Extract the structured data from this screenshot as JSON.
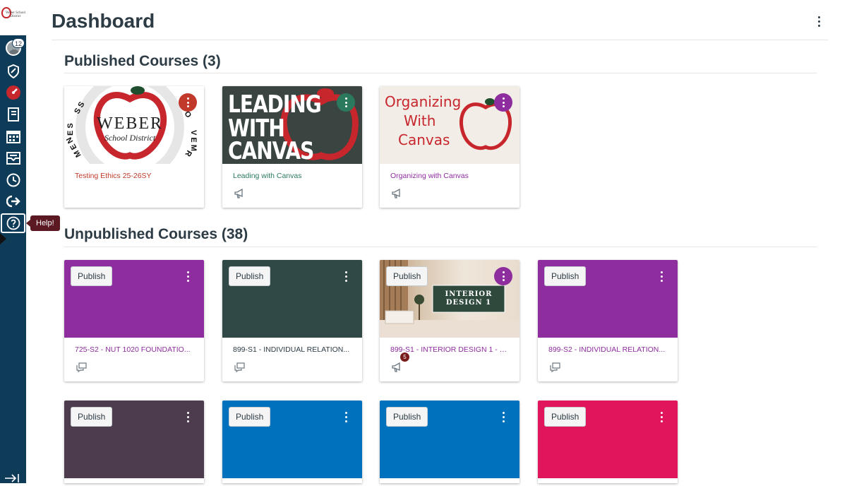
{
  "nav": {
    "logo_text": "Weber School District",
    "avatar_badge": "12",
    "tooltip": "Help!"
  },
  "header": {
    "title": "Dashboard"
  },
  "sections": {
    "published": {
      "title": "Published Courses (3)"
    },
    "unpublished": {
      "title": "Unpublished Courses (38)"
    }
  },
  "published_courses": [
    {
      "name": "Testing Ethics 25-26SY",
      "color": "#c0392b",
      "hero_text": [
        "WEBER",
        "School District"
      ],
      "ring_text": "ASSESSMENT · IMPROVEMENT"
    },
    {
      "name": "Leading with Canvas",
      "color": "#2b7a5e",
      "hero_text": [
        "LEADING",
        "WITH",
        "CANVAS"
      ]
    },
    {
      "name": "Organizing with Canvas",
      "color": "#8e2d9e",
      "hero_text": [
        "Organizing",
        "With",
        "Canvas"
      ]
    }
  ],
  "unpublished_courses": [
    {
      "name": "725-S2 - NUT 1020 FOUNDATIO...",
      "color": "#8e2d9e",
      "publish_label": "Publish"
    },
    {
      "name": "899-S1 - INDIVIDUAL RELATION...",
      "color": "#304846",
      "publish_label": "Publish"
    },
    {
      "name": "899-S1 - INTERIOR DESIGN 1 - B...",
      "color": "#8e2d9e",
      "publish_label": "Publish",
      "badge": "5",
      "hero_text": [
        "INTERIOR",
        "DESIGN 1"
      ]
    },
    {
      "name": "899-S2 - INDIVIDUAL RELATION...",
      "color": "#8e2d9e",
      "publish_label": "Publish"
    },
    {
      "color": "#4d3c4d",
      "publish_label": "Publish"
    },
    {
      "color": "#0071bd",
      "publish_label": "Publish"
    },
    {
      "color": "#0071bd",
      "publish_label": "Publish"
    },
    {
      "color": "#e0155b",
      "publish_label": "Publish"
    }
  ]
}
